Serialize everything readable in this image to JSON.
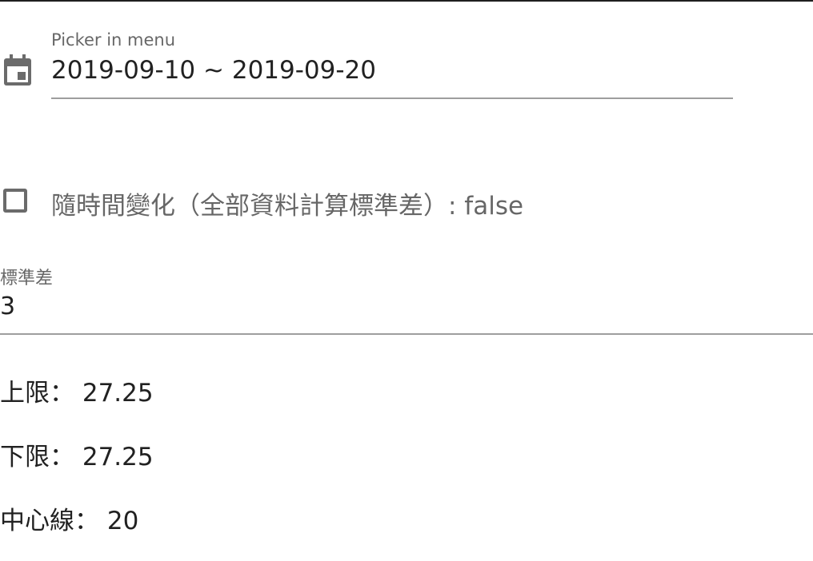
{
  "date_picker": {
    "label": "Picker in menu",
    "value": "2019-09-10 ~ 2019-09-20",
    "icon": "calendar-icon"
  },
  "toggle": {
    "label": "隨時間變化（全部資料計算標準差）: false",
    "checked": false
  },
  "std_dev": {
    "label": "標準差",
    "value": "3"
  },
  "stats": {
    "upper": "上限： 27.25",
    "lower": "下限： 27.25",
    "center": "中心線： 20"
  },
  "colors": {
    "icon": "#6b6b6b",
    "underline": "#9e9e9e",
    "text": "#212121"
  }
}
